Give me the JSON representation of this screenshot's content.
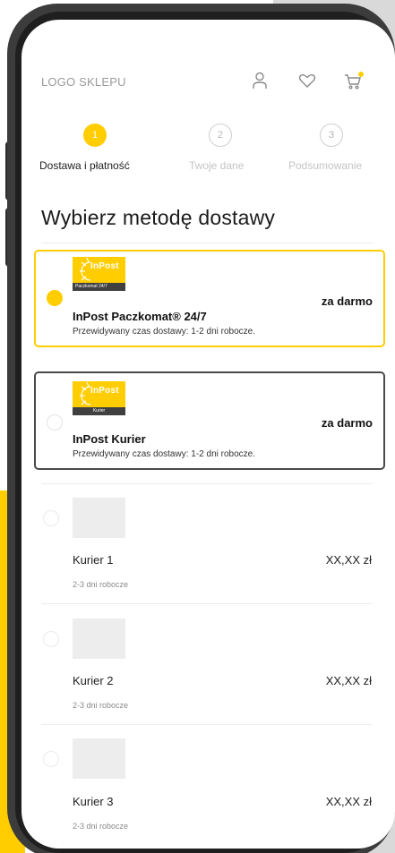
{
  "header": {
    "logo_text": "LOGO SKLEPU",
    "icons": [
      "user-icon",
      "heart-icon",
      "cart-icon"
    ]
  },
  "steps": [
    {
      "number": "1",
      "label": "Dostawa i płatność",
      "active": true
    },
    {
      "number": "2",
      "label": "Twoje dane",
      "active": false
    },
    {
      "number": "3",
      "label": "Podsumowanie",
      "active": false
    }
  ],
  "page_title": "Wybierz metodę dostawy",
  "delivery_options": [
    {
      "logo_text": "InPost",
      "logo_sub": "Paczkomat 24/7",
      "name": "InPost Paczkomat® 24/7",
      "description": "Przewidywany czas dostawy: 1-2 dni robocze.",
      "price": "za darmo",
      "selected": true
    },
    {
      "logo_text": "InPost",
      "logo_sub": "Kurier",
      "name": "InPost Kurier",
      "description": "Przewidywany czas dostawy: 1-2 dni robocze.",
      "price": "za darmo",
      "selected": false
    },
    {
      "name": "Kurier 1",
      "description": "2-3 dni robocze",
      "price": "XX,XX zł",
      "selected": false
    },
    {
      "name": "Kurier 2",
      "description": "2-3 dni robocze",
      "price": "XX,XX zł",
      "selected": false
    },
    {
      "name": "Kurier 3",
      "description": "2-3 dni robocze",
      "price": "XX,XX zł",
      "selected": false
    }
  ],
  "colors": {
    "accent": "#ffcd00",
    "dark": "#3c3c3c",
    "text": "#1b1b1b",
    "muted": "#9a9a9a"
  }
}
